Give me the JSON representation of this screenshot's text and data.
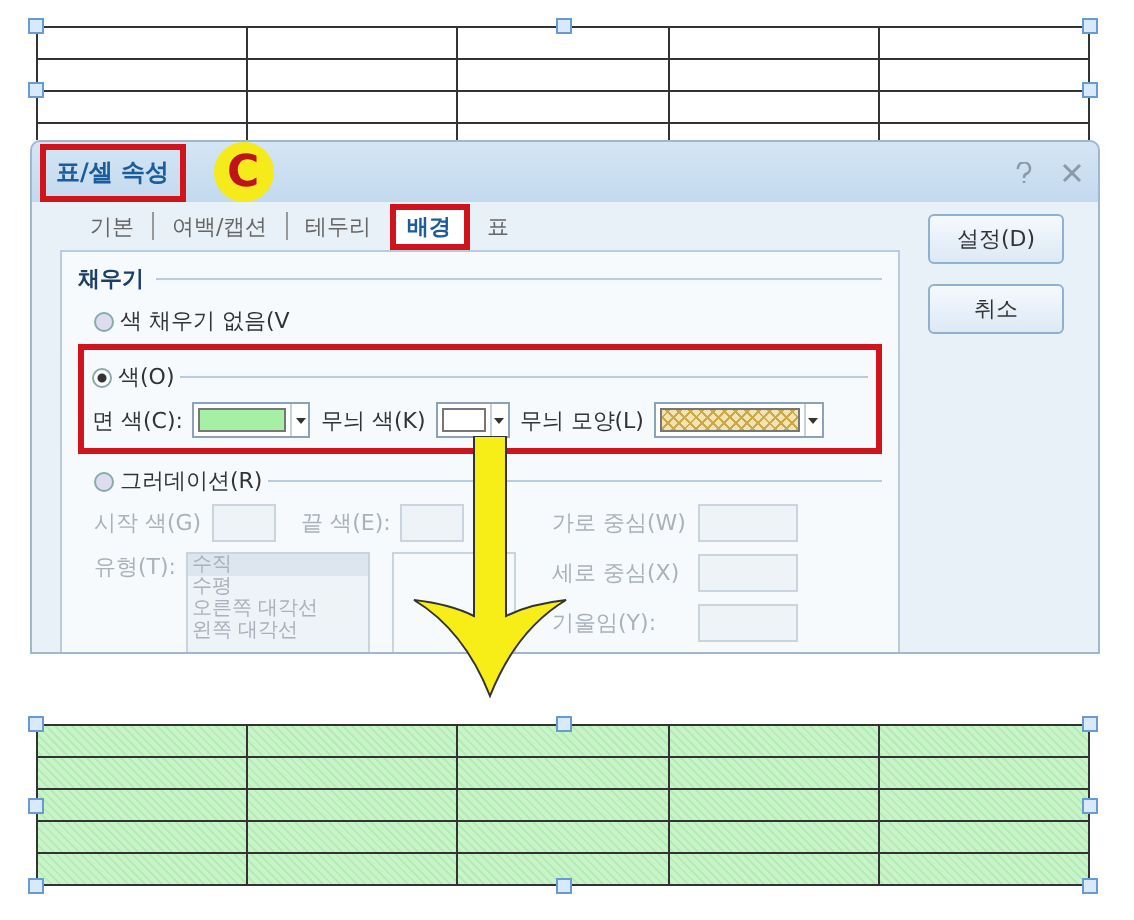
{
  "top_table": {
    "filled": false
  },
  "dialog": {
    "title": "표/셀 속성",
    "highlighted": true,
    "callout": "C",
    "tabs": [
      {
        "label": "기본",
        "selected": false,
        "highlighted": false
      },
      {
        "label": "여백/캡션",
        "selected": false,
        "highlighted": false
      },
      {
        "label": "테두리",
        "selected": false,
        "highlighted": false
      },
      {
        "label": "배경",
        "selected": true,
        "highlighted": true
      },
      {
        "label": "표",
        "selected": false,
        "highlighted": false
      }
    ],
    "buttons": [
      "설정(D)",
      "취소"
    ],
    "section": "채우기",
    "no_fill": {
      "label": "색 채우기 없음(V",
      "selected": false
    },
    "color_group": {
      "highlighted": true,
      "label": "색(O)",
      "selected": true,
      "fields": [
        {
          "label": "면 색(C):",
          "kind": "color",
          "color": "#a6f0a6"
        },
        {
          "label": "무늬 색(K)",
          "kind": "color",
          "color": "#ffffff"
        },
        {
          "label": "무늬 모양(L)",
          "kind": "pattern",
          "color": "#f3e3b0"
        }
      ]
    },
    "gradient": {
      "label": "그러데이션(R)",
      "selected": false,
      "disabled": true,
      "start": "시작 색(G)",
      "end": "끝 색(E):",
      "type_label": "유형(T):",
      "types": [
        {
          "label": "수직",
          "selected": true
        },
        {
          "label": "수평",
          "selected": false
        },
        {
          "label": "오른쪽 대각선",
          "selected": false
        },
        {
          "label": "왼쪽 대각선",
          "selected": false
        }
      ],
      "spins": [
        "가로 중심(W)",
        "세로 중심(X)",
        "기울임(Y):"
      ]
    }
  },
  "result_table": {
    "filled": true
  }
}
